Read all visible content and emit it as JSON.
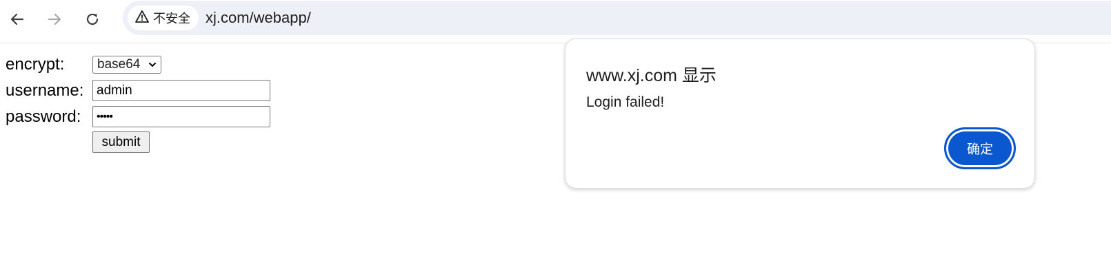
{
  "browser": {
    "security_label": "不安全",
    "url": "xj.com/webapp/"
  },
  "form": {
    "encrypt_label": "encrypt:",
    "encrypt_value": "base64",
    "username_label": "username:",
    "username_value": "admin",
    "password_label": "password:",
    "password_value": "•••••",
    "submit_label": "submit"
  },
  "dialog": {
    "title": "www.xj.com 显示",
    "message": "Login failed!",
    "ok_label": "确定"
  }
}
